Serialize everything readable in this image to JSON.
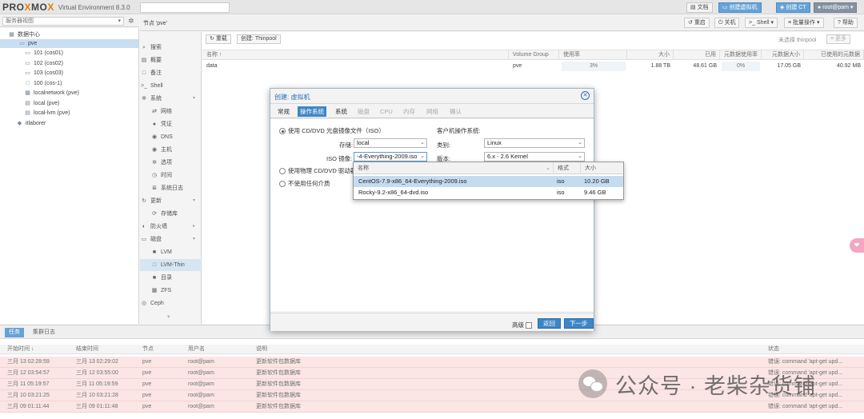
{
  "topbar": {
    "logo_prefix": "PRO",
    "logo_x": "X",
    "logo_suffix": "MO",
    "logo_x2": "X",
    "version": "Virtual Environment 8.3.0",
    "search_placeholder": "",
    "docs": "文档",
    "create_vm": "创建虚拟机",
    "create_ct": "创建 CT",
    "user": "root@pam"
  },
  "left": {
    "view": "服务器视图",
    "tree": [
      {
        "label": "数据中心",
        "icon": "datacenter-icon",
        "level": 0
      },
      {
        "label": "pve",
        "icon": "node-icon",
        "level": 1,
        "selected": true
      },
      {
        "label": "101 (cos01)",
        "icon": "vm-icon",
        "level": 2
      },
      {
        "label": "102 (cos02)",
        "icon": "vm-icon",
        "level": 2
      },
      {
        "label": "103 (cos03)",
        "icon": "vm-icon",
        "level": 2
      },
      {
        "label": "100 (cos-1)",
        "icon": "template-icon",
        "level": 2
      },
      {
        "label": "localnetwork (pve)",
        "icon": "network-icon",
        "level": 2
      },
      {
        "label": "local (pve)",
        "icon": "storage-icon",
        "level": 2
      },
      {
        "label": "local-lvm (pve)",
        "icon": "storage-icon",
        "level": 2
      },
      {
        "label": "itlaborer",
        "icon": "tag-icon",
        "level": 1
      }
    ]
  },
  "content_header": {
    "title": "节点 'pve'",
    "restart": "重启",
    "shutdown": "关机",
    "shell": "Shell",
    "bulk": "批量操作",
    "help": "帮助"
  },
  "nav": [
    {
      "label": "搜索",
      "icon": "search-icon"
    },
    {
      "label": "概要",
      "icon": "summary-icon"
    },
    {
      "label": "备注",
      "icon": "notes-icon"
    },
    {
      "label": "Shell",
      "icon": "shell-icon"
    },
    {
      "label": "系统",
      "icon": "gear-icon",
      "chev": true
    },
    {
      "label": "网络",
      "icon": "network-icon",
      "sub": true
    },
    {
      "label": "凭证",
      "icon": "cert-icon",
      "sub": true
    },
    {
      "label": "DNS",
      "icon": "globe-icon",
      "sub": true
    },
    {
      "label": "主机",
      "icon": "host-icon",
      "sub": true
    },
    {
      "label": "选项",
      "icon": "options-icon",
      "sub": true
    },
    {
      "label": "时间",
      "icon": "clock-icon",
      "sub": true
    },
    {
      "label": "系统日志",
      "icon": "log-icon",
      "sub": true
    },
    {
      "label": "更新",
      "icon": "refresh-icon",
      "chev": true
    },
    {
      "label": "存储库",
      "icon": "repo-icon",
      "sub": true
    },
    {
      "label": "防火墙",
      "icon": "shield-icon",
      "chev": true
    },
    {
      "label": "磁盘",
      "icon": "disk-icon",
      "chev": true
    },
    {
      "label": "LVM",
      "icon": "lvm-icon",
      "sub": true
    },
    {
      "label": "LVM-Thin",
      "icon": "lvmthin-icon",
      "sub": true,
      "selected": true
    },
    {
      "label": "目录",
      "icon": "folder-icon",
      "sub": true
    },
    {
      "label": "ZFS",
      "icon": "zfs-icon",
      "sub": true
    },
    {
      "label": "Ceph",
      "icon": "ceph-icon",
      "chev": true
    }
  ],
  "main": {
    "reload": "重载",
    "create_thinpool": "创建: Thinpool",
    "no_selection": "未选择 thinpool",
    "more": "更多",
    "columns": [
      "名称 ↑",
      "Volume Group",
      "使用率",
      "大小",
      "已用",
      "元数据使用率",
      "元数据大小",
      "已使用的元数据"
    ],
    "rows": [
      [
        "data",
        "pve",
        "3%",
        "1.88 TB",
        "48.61 GB",
        "0%",
        "17.05 GB",
        "40.92 MB"
      ]
    ]
  },
  "bottom": {
    "tab_tasks": "任务",
    "tab_cluster": "集群日志",
    "columns": [
      "开始时间 ↓",
      "结束时间",
      "节点",
      "用户名",
      "说明",
      "状态"
    ],
    "rows": [
      [
        "三月 13 02:28:59",
        "三月 13 02:29:02",
        "pve",
        "root@pam",
        "更新软件包数据库",
        "错误: command 'apt-get upd..."
      ],
      [
        "三月 12 03:54:57",
        "三月 12 03:55:00",
        "pve",
        "root@pam",
        "更新软件包数据库",
        "错误: command 'apt-get upd..."
      ],
      [
        "三月 11 05:19:57",
        "三月 11 05:19:59",
        "pve",
        "root@pam",
        "更新软件包数据库",
        "错误: command 'apt-get upd..."
      ],
      [
        "三月 10 03:21:25",
        "三月 10 03:21:28",
        "pve",
        "root@pam",
        "更新软件包数据库",
        "错误: command 'apt-get upd..."
      ],
      [
        "三月 09 01:11:44",
        "三月 09 01:11:48",
        "pve",
        "root@pam",
        "更新软件包数据库",
        "错误: command 'apt-get upd..."
      ]
    ]
  },
  "modal": {
    "title": "创建: 虚拟机",
    "tabs": [
      {
        "label": "常规",
        "state": "normal"
      },
      {
        "label": "操作系统",
        "state": "active"
      },
      {
        "label": "系统",
        "state": "normal"
      },
      {
        "label": "磁盘",
        "state": "disabled"
      },
      {
        "label": "CPU",
        "state": "disabled"
      },
      {
        "label": "内存",
        "state": "disabled"
      },
      {
        "label": "网络",
        "state": "disabled"
      },
      {
        "label": "确认",
        "state": "disabled"
      }
    ],
    "opt_iso": "使用 CD/DVD 光盘镜像文件（ISO）",
    "storage_label": "存储:",
    "storage_value": "local",
    "iso_label": "ISO 镜像:",
    "iso_value": "-4-Everything-2009.iso",
    "opt_physical": "使用物理 CD/DVD 驱动器",
    "opt_none": "不使用任何介质",
    "guest_os_header": "客户机操作系统:",
    "type_label": "类别:",
    "type_value": "Linux",
    "version_label": "版本:",
    "version_value": "6.x - 2.6 Kernel",
    "advanced": "高级",
    "back": "返回",
    "next": "下一步"
  },
  "iso_dropdown": {
    "columns": [
      "名称",
      "格式",
      "大小"
    ],
    "rows": [
      {
        "name": "CentOS-7.9-x86_64-Everything-2009.iso",
        "format": "iso",
        "size": "10.20 GB",
        "selected": true
      },
      {
        "name": "Rocky-9.2-x86_64-dvd.iso",
        "format": "iso",
        "size": "9.46 GB",
        "selected": false
      }
    ]
  },
  "watermark": {
    "text": "公众号 · 老柴杂货铺"
  },
  "side_badge": "❤"
}
